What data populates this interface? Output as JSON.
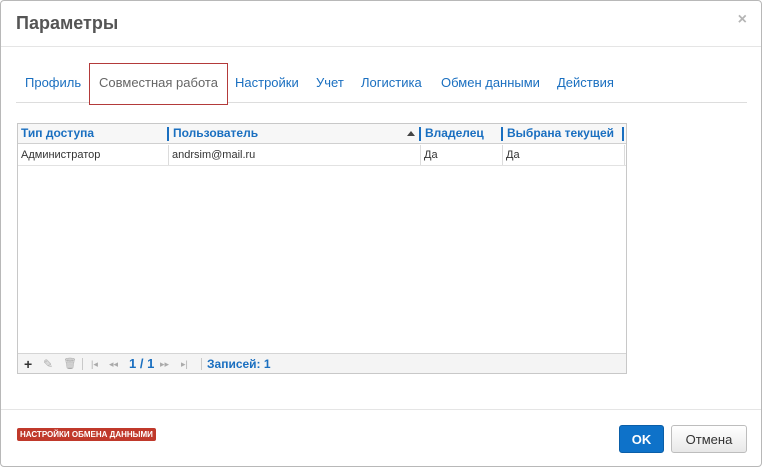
{
  "dialog": {
    "title": "Параметры",
    "close_glyph": "×"
  },
  "tabs": [
    {
      "label": "Профиль",
      "active": false
    },
    {
      "label": "Совместная работа",
      "active": true
    },
    {
      "label": "Настройки",
      "active": false
    },
    {
      "label": "Учет",
      "active": false
    },
    {
      "label": "Логистика",
      "active": false
    },
    {
      "label": "Обмен данными",
      "active": false
    },
    {
      "label": "Действия",
      "active": false
    }
  ],
  "grid": {
    "columns": [
      "Тип доступа",
      "Пользователь",
      "Владелец",
      "Выбрана текущей"
    ],
    "sorted_column": "Пользователь",
    "rows": [
      [
        "Администратор",
        "andrsim@mail.ru",
        "Да",
        "Да"
      ]
    ],
    "pager": {
      "add_icon": "plus-icon",
      "edit_icon": "pencil-icon",
      "delete_icon": "trash-icon",
      "first_glyph": "|◂",
      "prev_glyph": "◂◂",
      "page": "1 / 1",
      "next_glyph": "▸▸",
      "last_glyph": "▸|",
      "records": "Записей: 1"
    }
  },
  "footer": {
    "badge": "НАСТРОЙКИ ОБМЕНА ДАННЫМИ",
    "ok_label": "OK",
    "cancel_label": "Отмена"
  },
  "colors": {
    "link": "#1a6fc0",
    "active_tab_border": "#b33a3a",
    "badge_bg": "#c0392b",
    "ok_button": "#0e72c9"
  }
}
